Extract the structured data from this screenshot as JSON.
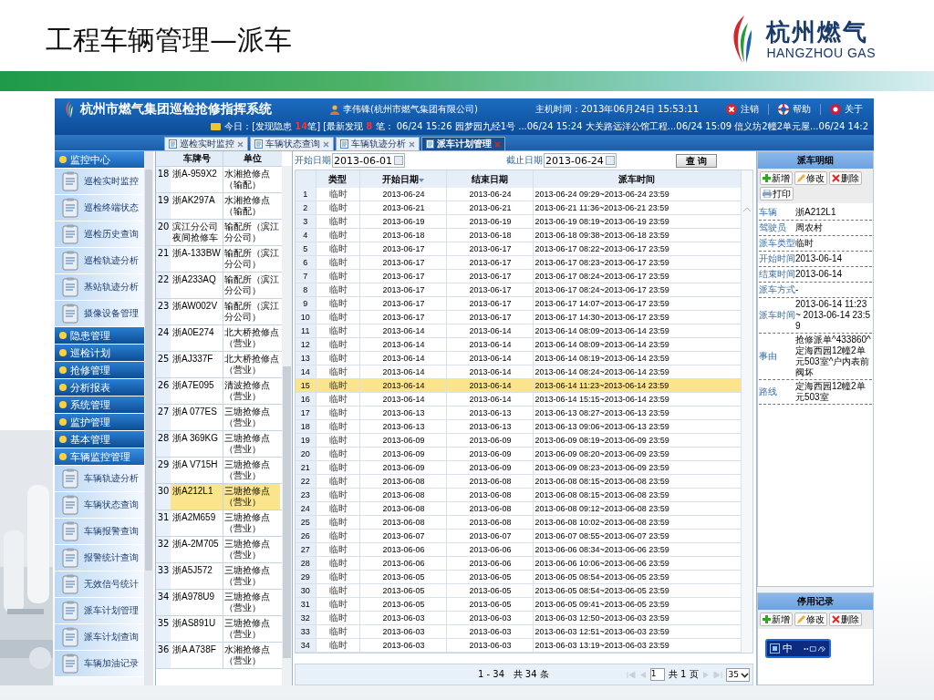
{
  "slide": {
    "title": "工程车辆管理—派车",
    "brand": {
      "name": "杭州燃气",
      "latin": "HANGZHOU GAS"
    }
  },
  "app": {
    "title": "杭州市燃气集团巡检抢修指挥系统",
    "user": "李伟锋(杭州市燃气集团有限公司)",
    "host_time": "主机时间：2013年06月24日 15:53:11",
    "header_buttons": [
      {
        "label": "注销",
        "kind": "logout"
      },
      {
        "label": "帮助",
        "kind": "help"
      },
      {
        "label": "关于",
        "kind": "about"
      }
    ],
    "notice": [
      {
        "text": "今日：[发现隐患 ",
        "kind": "plain"
      },
      {
        "text": "14",
        "kind": "count"
      },
      {
        "text": "笔] [最新发现 ",
        "kind": "plain"
      },
      {
        "text": "8",
        "kind": "count"
      },
      {
        "text": " 笔： 06/24 15:26 园梦园九经1号 ...06/24 15:24 大关路远洋公馆工程...06/24 15:09 信义坊2幢2单元屋...06/24 14:2",
        "kind": "plain"
      }
    ]
  },
  "tabs": [
    {
      "label": "巡检实时监控",
      "selected": false
    },
    {
      "label": "车辆状态查询",
      "selected": false
    },
    {
      "label": "车辆轨迹分析",
      "selected": false
    },
    {
      "label": "派车计划管理",
      "selected": true
    }
  ],
  "sidebar": {
    "groups": [
      {
        "title": "监控中心",
        "expanded": true,
        "items": [
          "巡检实时监控",
          "巡检终端状态",
          "巡检历史查询",
          "巡检轨迹分析",
          "基站轨迹分析",
          "摄像设备管理"
        ]
      },
      {
        "title": "隐患管理",
        "expanded": false
      },
      {
        "title": "巡检计划",
        "expanded": false
      },
      {
        "title": "抢修管理",
        "expanded": false
      },
      {
        "title": "分析报表",
        "expanded": false
      },
      {
        "title": "系统管理",
        "expanded": false
      },
      {
        "title": "监护管理",
        "expanded": false
      },
      {
        "title": "基本管理",
        "expanded": false
      },
      {
        "title": "车辆监控管理",
        "expanded": true,
        "items": [
          "车辆轨迹分析",
          "车辆状态查询",
          "车辆报警查询",
          "报警统计查询",
          "无效信号统计",
          "派车计划管理",
          "派车计划查询",
          "车辆加油记录"
        ]
      }
    ]
  },
  "vehicles": {
    "columns": [
      "车牌号",
      "单位"
    ],
    "rows": [
      {
        "n": "18",
        "plate": "浙A-959X2",
        "unit": "水湘抢修点（输配）",
        "selected": false
      },
      {
        "n": "19",
        "plate": "浙AK297A",
        "unit": "水湘抢修点（输配）",
        "selected": false
      },
      {
        "n": "20",
        "plate": "滨江分公司夜间抢修车",
        "unit": "输配所（滨江分公司）",
        "selected": false
      },
      {
        "n": "21",
        "plate": "浙A-133BW",
        "unit": "输配所（滨江分公司）",
        "selected": false
      },
      {
        "n": "22",
        "plate": "浙A233AQ",
        "unit": "输配所（滨江分公司）",
        "selected": false
      },
      {
        "n": "23",
        "plate": "浙AW002V",
        "unit": "输配所（滨江分公司）",
        "selected": false
      },
      {
        "n": "24",
        "plate": "浙A0E274",
        "unit": "北大桥抢修点（营业）",
        "selected": false
      },
      {
        "n": "25",
        "plate": "浙AJ337F",
        "unit": "北大桥抢修点（营业）",
        "selected": false
      },
      {
        "n": "26",
        "plate": "浙A7E095",
        "unit": "清波抢修点（营业）",
        "selected": false
      },
      {
        "n": "27",
        "plate": "浙A 077ES",
        "unit": "三塘抢修点（营业）",
        "selected": false
      },
      {
        "n": "28",
        "plate": "浙A 369KG",
        "unit": "三塘抢修点（营业）",
        "selected": false
      },
      {
        "n": "29",
        "plate": "浙A V715H",
        "unit": "三塘抢修点（营业）",
        "selected": false
      },
      {
        "n": "30",
        "plate": "浙A212L1",
        "unit": "三塘抢修点（营业）",
        "selected": true
      },
      {
        "n": "31",
        "plate": "浙A2M659",
        "unit": "三塘抢修点（营业）",
        "selected": false
      },
      {
        "n": "32",
        "plate": "浙A-2M705",
        "unit": "三塘抢修点（营业）",
        "selected": false
      },
      {
        "n": "33",
        "plate": "浙A5J572",
        "unit": "三塘抢修点（营业）",
        "selected": false
      },
      {
        "n": "34",
        "plate": "浙A978U9",
        "unit": "三塘抢修点（营业）",
        "selected": false
      },
      {
        "n": "35",
        "plate": "浙AS891U",
        "unit": "三塘抢修点（营业）",
        "selected": false
      },
      {
        "n": "36",
        "plate": "浙A A738F",
        "unit": "水湘抢修点（营业）",
        "selected": false
      }
    ]
  },
  "filter": {
    "start_label": "开始日期",
    "start": "2013-06-01",
    "end_label": "截止日期",
    "end": "2013-06-24",
    "button": "查 询"
  },
  "plans": {
    "columns": [
      {
        "label": "类型",
        "sorted": false
      },
      {
        "label": "开始日期",
        "sorted": true
      },
      {
        "label": "结束日期",
        "sorted": false
      },
      {
        "label": "派车时间",
        "sorted": false
      }
    ],
    "rows": [
      {
        "n": "1",
        "type": "临时",
        "start": "2013-06-24",
        "end": "2013-06-24",
        "time": "2013-06-24 09:29~2013-06-24 23:59",
        "selected": false
      },
      {
        "n": "2",
        "type": "临时",
        "start": "2013-06-21",
        "end": "2013-06-21",
        "time": "2013-06-21 11:36~2013-06-21 23:59",
        "selected": false
      },
      {
        "n": "3",
        "type": "临时",
        "start": "2013-06-19",
        "end": "2013-06-19",
        "time": "2013-06-19 08:19~2013-06-19 23:59",
        "selected": false
      },
      {
        "n": "4",
        "type": "临时",
        "start": "2013-06-18",
        "end": "2013-06-18",
        "time": "2013-06-18 09:38~2013-06-18 23:59",
        "selected": false
      },
      {
        "n": "5",
        "type": "临时",
        "start": "2013-06-17",
        "end": "2013-06-17",
        "time": "2013-06-17 08:22~2013-06-17 23:59",
        "selected": false
      },
      {
        "n": "6",
        "type": "临时",
        "start": "2013-06-17",
        "end": "2013-06-17",
        "time": "2013-06-17 08:23~2013-06-17 23:59",
        "selected": false
      },
      {
        "n": "7",
        "type": "临时",
        "start": "2013-06-17",
        "end": "2013-06-17",
        "time": "2013-06-17 08:24~2013-06-17 23:59",
        "selected": false
      },
      {
        "n": "8",
        "type": "临时",
        "start": "2013-06-17",
        "end": "2013-06-17",
        "time": "2013-06-17 08:24~2013-06-17 23:59",
        "selected": false
      },
      {
        "n": "9",
        "type": "临时",
        "start": "2013-06-17",
        "end": "2013-06-17",
        "time": "2013-06-17 14:07~2013-06-17 23:59",
        "selected": false
      },
      {
        "n": "10",
        "type": "临时",
        "start": "2013-06-17",
        "end": "2013-06-17",
        "time": "2013-06-17 14:30~2013-06-17 23:59",
        "selected": false
      },
      {
        "n": "11",
        "type": "临时",
        "start": "2013-06-14",
        "end": "2013-06-14",
        "time": "2013-06-14 08:09~2013-06-14 23:59",
        "selected": false
      },
      {
        "n": "12",
        "type": "临时",
        "start": "2013-06-14",
        "end": "2013-06-14",
        "time": "2013-06-14 08:09~2013-06-14 23:59",
        "selected": false
      },
      {
        "n": "13",
        "type": "临时",
        "start": "2013-06-14",
        "end": "2013-06-14",
        "time": "2013-06-14 08:19~2013-06-14 23:59",
        "selected": false
      },
      {
        "n": "14",
        "type": "临时",
        "start": "2013-06-14",
        "end": "2013-06-14",
        "time": "2013-06-14 08:24~2013-06-14 23:59",
        "selected": false
      },
      {
        "n": "15",
        "type": "临时",
        "start": "2013-06-14",
        "end": "2013-06-14",
        "time": "2013-06-14 11:23~2013-06-14 23:59",
        "selected": true
      },
      {
        "n": "16",
        "type": "临时",
        "start": "2013-06-14",
        "end": "2013-06-14",
        "time": "2013-06-14 15:15~2013-06-14 23:59",
        "selected": false
      },
      {
        "n": "17",
        "type": "临时",
        "start": "2013-06-13",
        "end": "2013-06-13",
        "time": "2013-06-13 08:27~2013-06-13 23:59",
        "selected": false
      },
      {
        "n": "18",
        "type": "临时",
        "start": "2013-06-13",
        "end": "2013-06-13",
        "time": "2013-06-13 09:06~2013-06-13 23:59",
        "selected": false
      },
      {
        "n": "19",
        "type": "临时",
        "start": "2013-06-09",
        "end": "2013-06-09",
        "time": "2013-06-09 08:19~2013-06-09 23:59",
        "selected": false
      },
      {
        "n": "20",
        "type": "临时",
        "start": "2013-06-09",
        "end": "2013-06-09",
        "time": "2013-06-09 08:20~2013-06-09 23:59",
        "selected": false
      },
      {
        "n": "21",
        "type": "临时",
        "start": "2013-06-09",
        "end": "2013-06-09",
        "time": "2013-06-09 08:23~2013-06-09 23:59",
        "selected": false
      },
      {
        "n": "22",
        "type": "临时",
        "start": "2013-06-08",
        "end": "2013-06-08",
        "time": "2013-06-08 08:15~2013-06-08 23:59",
        "selected": false
      },
      {
        "n": "23",
        "type": "临时",
        "start": "2013-06-08",
        "end": "2013-06-08",
        "time": "2013-06-08 08:15~2013-06-08 23:59",
        "selected": false
      },
      {
        "n": "24",
        "type": "临时",
        "start": "2013-06-08",
        "end": "2013-06-08",
        "time": "2013-06-08 09:12~2013-06-08 23:59",
        "selected": false
      },
      {
        "n": "25",
        "type": "临时",
        "start": "2013-06-08",
        "end": "2013-06-08",
        "time": "2013-06-08 10:02~2013-06-08 23:59",
        "selected": false
      },
      {
        "n": "26",
        "type": "临时",
        "start": "2013-06-07",
        "end": "2013-06-07",
        "time": "2013-06-07 08:55~2013-06-07 23:59",
        "selected": false
      },
      {
        "n": "27",
        "type": "临时",
        "start": "2013-06-06",
        "end": "2013-06-06",
        "time": "2013-06-06 08:34~2013-06-06 23:59",
        "selected": false
      },
      {
        "n": "28",
        "type": "临时",
        "start": "2013-06-06",
        "end": "2013-06-06",
        "time": "2013-06-06 10:06~2013-06-06 23:59",
        "selected": false
      },
      {
        "n": "29",
        "type": "临时",
        "start": "2013-06-05",
        "end": "2013-06-05",
        "time": "2013-06-05 08:54~2013-06-05 23:59",
        "selected": false
      },
      {
        "n": "30",
        "type": "临时",
        "start": "2013-06-05",
        "end": "2013-06-05",
        "time": "2013-06-05 08:54~2013-06-05 23:59",
        "selected": false
      },
      {
        "n": "31",
        "type": "临时",
        "start": "2013-06-05",
        "end": "2013-06-05",
        "time": "2013-06-05 09:41~2013-06-05 23:59",
        "selected": false
      },
      {
        "n": "32",
        "type": "临时",
        "start": "2013-06-03",
        "end": "2013-06-03",
        "time": "2013-06-03 12:50~2013-06-03 23:59",
        "selected": false
      },
      {
        "n": "33",
        "type": "临时",
        "start": "2013-06-03",
        "end": "2013-06-03",
        "time": "2013-06-03 12:51~2013-06-03 23:59",
        "selected": false
      },
      {
        "n": "34",
        "type": "临时",
        "start": "2013-06-03",
        "end": "2013-06-03",
        "time": "2013-06-03 13:19~2013-06-03 23:59",
        "selected": false
      }
    ],
    "summary": "1 - 34   共 34 条",
    "page": "1",
    "pages": "共 1 页",
    "page_size": "35"
  },
  "detail": {
    "title": "派车明细",
    "buttons": [
      {
        "label": "新增",
        "kind": "add"
      },
      {
        "label": "修改",
        "kind": "edit"
      },
      {
        "label": "删除",
        "kind": "delete"
      },
      {
        "label": "打印",
        "kind": "print"
      }
    ],
    "fields": [
      {
        "label": "车辆",
        "value": "浙A212L1"
      },
      {
        "label": "驾驶员",
        "value": "周农村"
      },
      {
        "label": "派车类型",
        "value": "临时"
      },
      {
        "label": "开始时间",
        "value": "2013-06-14"
      },
      {
        "label": "结束时间",
        "value": "2013-06-14"
      },
      {
        "label": "派车方式",
        "value": "-"
      },
      {
        "label": "派车时间",
        "value": "2013-06-14 11:23 ~ 2013-06-14 23:59"
      },
      {
        "label": "事由",
        "value": "抢修派单^433860^定海西园12幢2单元503室^户内表前阀坏"
      },
      {
        "label": "路线",
        "value": "定海西园12幢2单元503室"
      }
    ]
  },
  "stop_records": {
    "title": "停用记录",
    "buttons": [
      {
        "label": "新增",
        "kind": "add"
      },
      {
        "label": "修改",
        "kind": "edit"
      },
      {
        "label": "删除",
        "kind": "delete"
      }
    ]
  },
  "ime": {
    "mode": "中"
  }
}
